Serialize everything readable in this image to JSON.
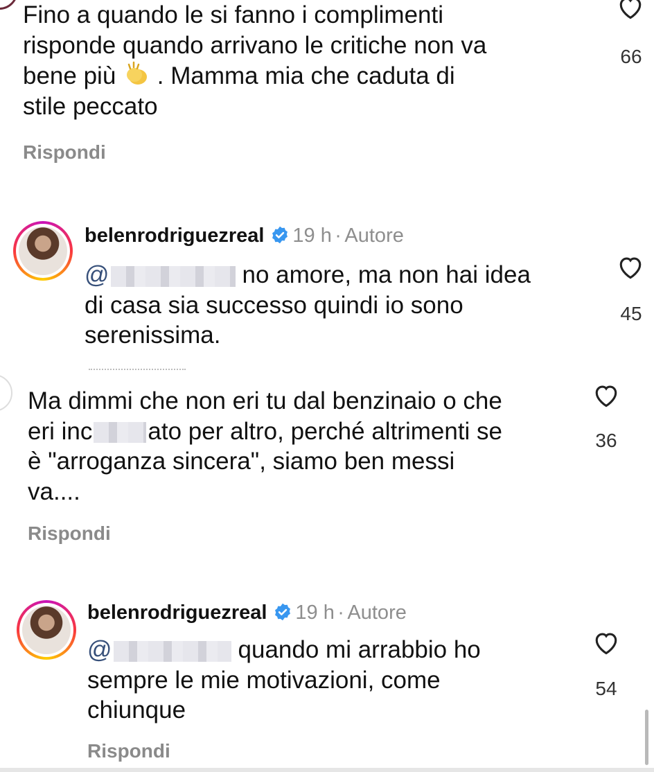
{
  "comments": [
    {
      "lines": [
        "Fino a quando le si fanno i complimenti",
        "risponde quando arrivano le critiche non va",
        "bene più",
        ". Mamma mia che caduta di",
        "stile peccato"
      ],
      "likes": "66",
      "reply_label": "Rispondi"
    },
    {
      "username": "belenrodriguezreal",
      "time": "19 h",
      "separator": "·",
      "role": "Autore",
      "mention_prefix": "@",
      "lines": [
        "no amore, ma non hai idea",
        "di casa sia successo quindi io sono",
        "serenissima."
      ],
      "likes": "45"
    },
    {
      "lines": [
        "Ma dimmi che non eri tu dal benzinaio o che",
        "eri inc",
        "ato per altro, perché altrimenti se",
        "è \"arroganza sincera\", siamo ben messi",
        "va...."
      ],
      "likes": "36",
      "reply_label": "Rispondi"
    },
    {
      "username": "belenrodriguezreal",
      "time": "19 h",
      "separator": "·",
      "role": "Autore",
      "mention_prefix": "@",
      "lines": [
        "quando mi arrabbio ho",
        "sempre le mie motivazioni, come",
        "chiunque"
      ],
      "likes": "54",
      "reply_label": "Rispondi"
    }
  ],
  "icons": {
    "heart": "heart-outline-icon",
    "verified": "verified-badge-icon",
    "emoji": "clapping-hands-emoji"
  },
  "colors": {
    "text": "#111111",
    "muted": "#8e8e8e",
    "verified": "#3897f0",
    "mention": "#37507a"
  }
}
